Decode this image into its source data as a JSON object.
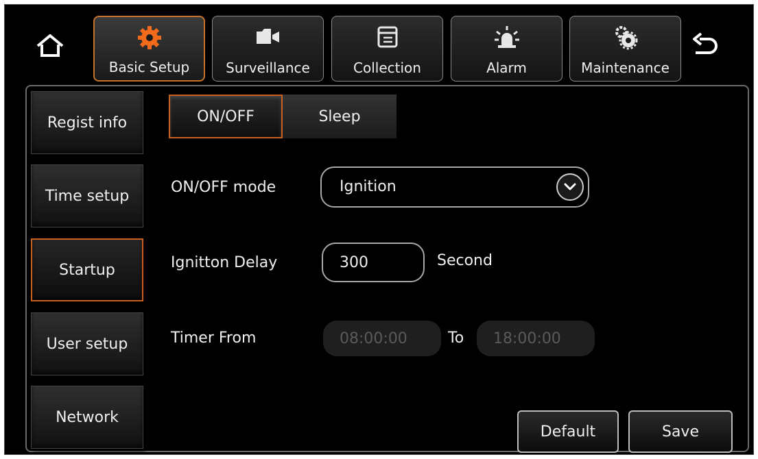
{
  "top_nav": {
    "home_icon": "home-icon",
    "back_icon": "back-arrow-icon",
    "tabs": [
      {
        "label": "Basic Setup",
        "icon": "gear-icon",
        "active": true
      },
      {
        "label": "Surveillance",
        "icon": "camera-icon",
        "active": false
      },
      {
        "label": "Collection",
        "icon": "window-icon",
        "active": false
      },
      {
        "label": "Alarm",
        "icon": "alarm-light-icon",
        "active": false
      },
      {
        "label": "Maintenance",
        "icon": "gears-icon",
        "active": false
      }
    ]
  },
  "sidebar": {
    "items": [
      {
        "label": "Regist info"
      },
      {
        "label": "Time setup"
      },
      {
        "label": "Startup",
        "active": true
      },
      {
        "label": "User setup"
      },
      {
        "label": "Network"
      }
    ]
  },
  "subtabs": [
    {
      "label": "ON/OFF",
      "active": true
    },
    {
      "label": "Sleep",
      "active": false
    }
  ],
  "form": {
    "mode_label": "ON/OFF mode",
    "mode_value": "Ignition",
    "delay_label": "Ignitton Delay",
    "delay_value": "300",
    "delay_unit": "Second",
    "timer_label": "Timer From",
    "timer_from": "08:00:00",
    "timer_to_label": "To",
    "timer_to": "18:00:00"
  },
  "buttons": {
    "default_label": "Default",
    "save_label": "Save"
  },
  "colors": {
    "accent": "#c8601e",
    "background": "#000000"
  }
}
